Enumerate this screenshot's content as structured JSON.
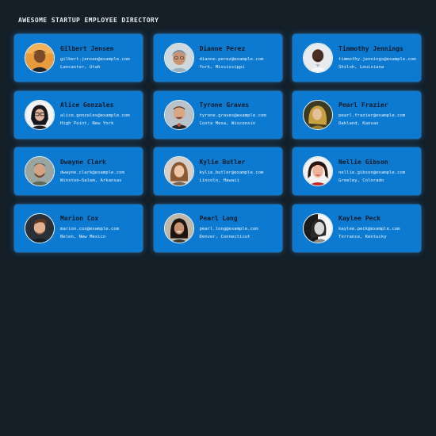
{
  "header": {
    "title": "AWESOME STARTUP EMPLOYEE DIRECTORY"
  },
  "colors": {
    "background": "#141f28",
    "card": "#0c7ad0",
    "name_text": "#0d1a26",
    "detail_text": "#eef5fb"
  },
  "employees": [
    {
      "name": "Gilbert Jensen",
      "email": "gilbert.jensen@example.com",
      "location": "Lancaster, Utah",
      "photo": "avatar-photo"
    },
    {
      "name": "Dianne Perez",
      "email": "dianne.perez@example.com",
      "location": "York, Mississippi",
      "photo": "avatar-photo"
    },
    {
      "name": "Timmothy Jennings",
      "email": "timmothy.jennings@example.com",
      "location": "Shiloh, Louisiana",
      "photo": "avatar-photo"
    },
    {
      "name": "Alice Gonzales",
      "email": "alice.gonzales@example.com",
      "location": "High Point, New York",
      "photo": "avatar-photo"
    },
    {
      "name": "Tyrone Graves",
      "email": "tyrone.graves@example.com",
      "location": "Costa Mesa, Wisconsin",
      "photo": "avatar-photo"
    },
    {
      "name": "Pearl Frazier",
      "email": "pearl.frazier@example.com",
      "location": "Oakland, Kansas",
      "photo": "avatar-photo"
    },
    {
      "name": "Dwayne Clark",
      "email": "dwayne.clark@example.com",
      "location": "Winston–Salem, Arkansas",
      "photo": "avatar-photo"
    },
    {
      "name": "Kylie Butler",
      "email": "kylie.butler@example.com",
      "location": "Lincoln, Hawaii",
      "photo": "avatar-photo"
    },
    {
      "name": "Nellie Gibson",
      "email": "nellie.gibson@example.com",
      "location": "Greeley, Colorado",
      "photo": "avatar-photo"
    },
    {
      "name": "Marion Cox",
      "email": "marion.cox@example.com",
      "location": "Belen, New Mexico",
      "photo": "avatar-photo"
    },
    {
      "name": "Pearl Long",
      "email": "pearl.long@example.com",
      "location": "Denver, Connecticut",
      "photo": "avatar-photo"
    },
    {
      "name": "Kaylee Peck",
      "email": "kaylee.peck@example.com",
      "location": "Torrance, Kentucky",
      "photo": "avatar-photo"
    }
  ]
}
